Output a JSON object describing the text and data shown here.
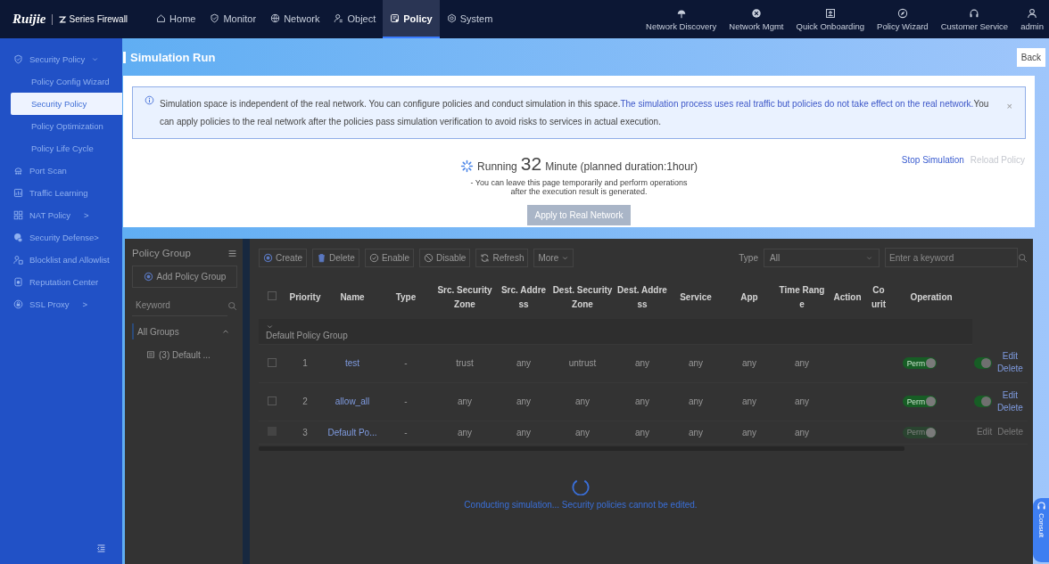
{
  "topbar": {
    "logo": "Ruijie",
    "product": "Series Firewall",
    "nav": [
      {
        "label": "Home",
        "selected": false
      },
      {
        "label": "Monitor",
        "selected": false
      },
      {
        "label": "Network",
        "selected": false
      },
      {
        "label": "Object",
        "selected": false
      },
      {
        "label": "Policy",
        "selected": true
      },
      {
        "label": "System",
        "selected": false
      }
    ],
    "tools": [
      {
        "label": "Network Discovery"
      },
      {
        "label": "Network Mgmt"
      },
      {
        "label": "Quick Onboarding"
      },
      {
        "label": "Policy Wizard"
      },
      {
        "label": "Customer Service"
      },
      {
        "label": "admin"
      }
    ]
  },
  "sidebar": {
    "items": [
      {
        "label": "Security Policy",
        "selected": false,
        "expanded": true,
        "children": [
          {
            "label": "Policy Config Wizard",
            "selected": false
          },
          {
            "label": "Security Policy",
            "selected": true
          },
          {
            "label": "Policy Optimization",
            "selected": false
          },
          {
            "label": "Policy Life Cycle",
            "selected": false
          }
        ]
      },
      {
        "label": "Port Scan",
        "selected": false
      },
      {
        "label": "Traffic Learning",
        "selected": false
      },
      {
        "label": "NAT Policy",
        "selected": false,
        "arrow": ">"
      },
      {
        "label": "Security Defense>",
        "selected": false
      },
      {
        "label": "Blocklist and Allowlist",
        "selected": false
      },
      {
        "label": "Reputation Center",
        "selected": false
      },
      {
        "label": "SSL Proxy",
        "selected": false,
        "arrow": ">"
      }
    ]
  },
  "page_header": {
    "title": "Simulation Run",
    "back": "Back"
  },
  "notice": {
    "segments": [
      {
        "kind": "plain",
        "text": "Simulation space is independent of the real network. You can configure policies and conduct simulation in this space."
      },
      {
        "kind": "highlight",
        "text": "The simulation process uses real traffic but policies do not take effect on the real network."
      },
      {
        "kind": "plain",
        "text": "You can apply policies to the real network after the policies pass simulation verification to avoid risks to services in actual execution."
      }
    ],
    "close": "×"
  },
  "simulation": {
    "running": "Running",
    "elapsed": "32",
    "duration": "Minute (planned duration:1hour)",
    "note": "- You can leave this page temporarily and perform operations after the execution result is generated.",
    "apply": {
      "label": "Apply to Real Network",
      "disabled": true
    },
    "actions": [
      {
        "label": "Stop Simulation",
        "disabled": false
      },
      {
        "label": "Reload Policy",
        "disabled": true
      }
    ]
  },
  "policy_groups": {
    "title": "Policy Group",
    "add": "Add Policy Group",
    "search": {
      "placeholder": "Keyword"
    },
    "tree": [
      {
        "label": "All Groups",
        "selected": true,
        "expanded": true,
        "children": [
          {
            "label": "(3) Default ...",
            "selected": false
          }
        ]
      }
    ]
  },
  "toolbar": {
    "buttons": [
      {
        "label": "Create"
      },
      {
        "label": "Delete"
      },
      {
        "label": "Enable"
      },
      {
        "label": "Disable"
      },
      {
        "label": "Refresh"
      },
      {
        "label": "More"
      }
    ],
    "type_filter": {
      "label": "Type",
      "value": "All"
    },
    "search": {
      "placeholder": "Enter a keyword"
    }
  },
  "table": {
    "select_all": {
      "checked": false
    },
    "columns": [
      "Priority",
      "Name",
      "Type",
      "Src. Security Zone",
      "Src. Address",
      "Dest. Security Zone",
      "Dest. Address",
      "Service",
      "App",
      "Time Range",
      "Action",
      "Co urit",
      "Operation"
    ],
    "group_row": {
      "label": "Default Policy Group",
      "expanded": true
    },
    "rows": [
      {
        "checked": false,
        "cells": [
          "1",
          "test",
          "-",
          "trust",
          "any",
          "untrust",
          "any",
          "any",
          "any",
          "any"
        ],
        "action": {
          "label": "Perm",
          "on": true
        },
        "enabled": true,
        "ops": [
          "Edit",
          "Delete"
        ]
      },
      {
        "checked": false,
        "cells": [
          "2",
          "allow_all",
          "-",
          "any",
          "any",
          "any",
          "any",
          "any",
          "any",
          "any"
        ],
        "action": {
          "label": "Perm",
          "on": true
        },
        "enabled": true,
        "ops": [
          "Edit",
          "Delete"
        ]
      },
      {
        "checked": false,
        "disabled": true,
        "cells": [
          "3",
          "Default Po...",
          "-",
          "any",
          "any",
          "any",
          "any",
          "any",
          "any",
          "any"
        ],
        "action": {
          "label": "Perm",
          "on": true
        },
        "ops": [
          "Edit",
          "Delete"
        ]
      }
    ]
  },
  "loading": {
    "text": "Conducting simulation... Security policies cannot be edited."
  },
  "consult": "Consult"
}
